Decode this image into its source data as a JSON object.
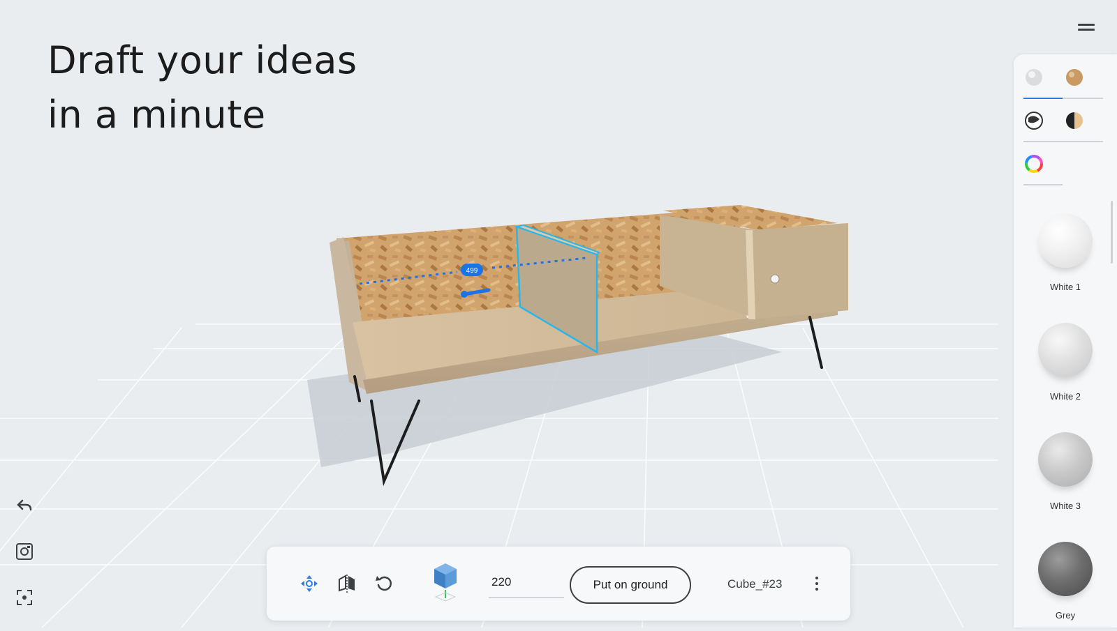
{
  "headline": {
    "line1": "Draft your ideas",
    "line2": "in a minute"
  },
  "scene": {
    "measurement_label": "499",
    "selection_color": "#29b6e8",
    "measure_color": "#1a73e8"
  },
  "top_right": {
    "menu_icon": "menu-icon"
  },
  "material_panel": {
    "row1": {
      "left_icon": "plain-material-icon",
      "right_icon": "wood-material-icon"
    },
    "row2": {
      "left_icon": "pattern-material-icon",
      "right_icon": "mixed-material-icon"
    },
    "row3": {
      "icon": "color-wheel-icon"
    },
    "materials": [
      {
        "label": "White 1",
        "color": "#f2f2f2"
      },
      {
        "label": "White 2",
        "color": "#e2e2e2"
      },
      {
        "label": "White 3",
        "color": "#cbcbcb"
      },
      {
        "label": "Grey",
        "color": "#6e6e6e"
      }
    ]
  },
  "left_tools": [
    {
      "icon": "undo-icon"
    },
    {
      "icon": "screenshot-icon"
    },
    {
      "icon": "focus-icon"
    }
  ],
  "toolbar": {
    "move_icon": "move-icon",
    "mirror_icon": "mirror-icon",
    "rotate_icon": "rotate-icon",
    "object_icon": "cube-icon",
    "dimension_value": "220",
    "ground_button_label": "Put on ground",
    "object_name": "Cube_#23",
    "more_icon": "more-vert-icon"
  },
  "colors": {
    "accent": "#2f7be5",
    "background": "#e9edf0",
    "panel": "#f6f7f8"
  }
}
